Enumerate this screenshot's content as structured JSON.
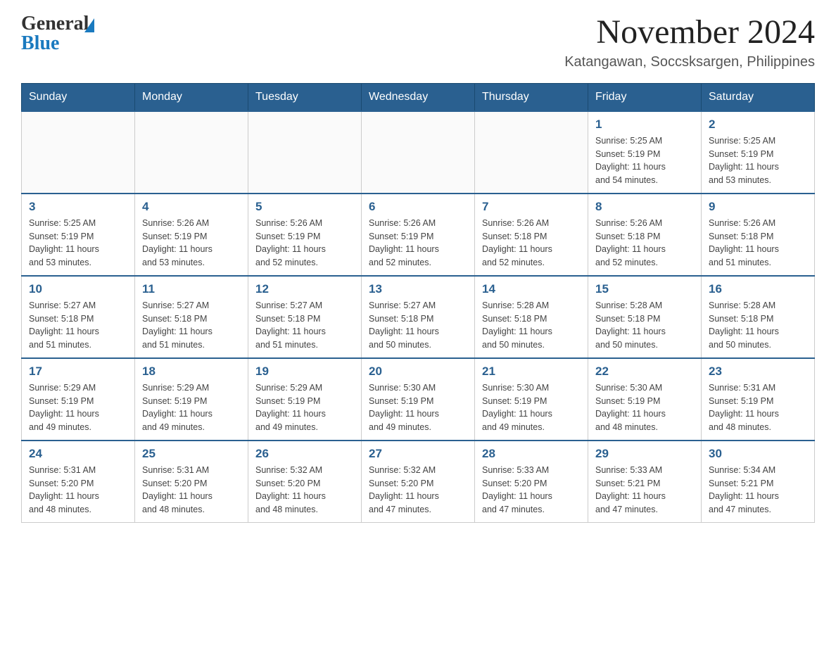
{
  "header": {
    "logo_general": "General",
    "logo_blue": "Blue",
    "month_year": "November 2024",
    "location": "Katangawan, Soccsksargen, Philippines"
  },
  "calendar": {
    "days_of_week": [
      "Sunday",
      "Monday",
      "Tuesday",
      "Wednesday",
      "Thursday",
      "Friday",
      "Saturday"
    ],
    "weeks": [
      [
        {
          "day": "",
          "info": ""
        },
        {
          "day": "",
          "info": ""
        },
        {
          "day": "",
          "info": ""
        },
        {
          "day": "",
          "info": ""
        },
        {
          "day": "",
          "info": ""
        },
        {
          "day": "1",
          "info": "Sunrise: 5:25 AM\nSunset: 5:19 PM\nDaylight: 11 hours\nand 54 minutes."
        },
        {
          "day": "2",
          "info": "Sunrise: 5:25 AM\nSunset: 5:19 PM\nDaylight: 11 hours\nand 53 minutes."
        }
      ],
      [
        {
          "day": "3",
          "info": "Sunrise: 5:25 AM\nSunset: 5:19 PM\nDaylight: 11 hours\nand 53 minutes."
        },
        {
          "day": "4",
          "info": "Sunrise: 5:26 AM\nSunset: 5:19 PM\nDaylight: 11 hours\nand 53 minutes."
        },
        {
          "day": "5",
          "info": "Sunrise: 5:26 AM\nSunset: 5:19 PM\nDaylight: 11 hours\nand 52 minutes."
        },
        {
          "day": "6",
          "info": "Sunrise: 5:26 AM\nSunset: 5:19 PM\nDaylight: 11 hours\nand 52 minutes."
        },
        {
          "day": "7",
          "info": "Sunrise: 5:26 AM\nSunset: 5:18 PM\nDaylight: 11 hours\nand 52 minutes."
        },
        {
          "day": "8",
          "info": "Sunrise: 5:26 AM\nSunset: 5:18 PM\nDaylight: 11 hours\nand 52 minutes."
        },
        {
          "day": "9",
          "info": "Sunrise: 5:26 AM\nSunset: 5:18 PM\nDaylight: 11 hours\nand 51 minutes."
        }
      ],
      [
        {
          "day": "10",
          "info": "Sunrise: 5:27 AM\nSunset: 5:18 PM\nDaylight: 11 hours\nand 51 minutes."
        },
        {
          "day": "11",
          "info": "Sunrise: 5:27 AM\nSunset: 5:18 PM\nDaylight: 11 hours\nand 51 minutes."
        },
        {
          "day": "12",
          "info": "Sunrise: 5:27 AM\nSunset: 5:18 PM\nDaylight: 11 hours\nand 51 minutes."
        },
        {
          "day": "13",
          "info": "Sunrise: 5:27 AM\nSunset: 5:18 PM\nDaylight: 11 hours\nand 50 minutes."
        },
        {
          "day": "14",
          "info": "Sunrise: 5:28 AM\nSunset: 5:18 PM\nDaylight: 11 hours\nand 50 minutes."
        },
        {
          "day": "15",
          "info": "Sunrise: 5:28 AM\nSunset: 5:18 PM\nDaylight: 11 hours\nand 50 minutes."
        },
        {
          "day": "16",
          "info": "Sunrise: 5:28 AM\nSunset: 5:18 PM\nDaylight: 11 hours\nand 50 minutes."
        }
      ],
      [
        {
          "day": "17",
          "info": "Sunrise: 5:29 AM\nSunset: 5:19 PM\nDaylight: 11 hours\nand 49 minutes."
        },
        {
          "day": "18",
          "info": "Sunrise: 5:29 AM\nSunset: 5:19 PM\nDaylight: 11 hours\nand 49 minutes."
        },
        {
          "day": "19",
          "info": "Sunrise: 5:29 AM\nSunset: 5:19 PM\nDaylight: 11 hours\nand 49 minutes."
        },
        {
          "day": "20",
          "info": "Sunrise: 5:30 AM\nSunset: 5:19 PM\nDaylight: 11 hours\nand 49 minutes."
        },
        {
          "day": "21",
          "info": "Sunrise: 5:30 AM\nSunset: 5:19 PM\nDaylight: 11 hours\nand 49 minutes."
        },
        {
          "day": "22",
          "info": "Sunrise: 5:30 AM\nSunset: 5:19 PM\nDaylight: 11 hours\nand 48 minutes."
        },
        {
          "day": "23",
          "info": "Sunrise: 5:31 AM\nSunset: 5:19 PM\nDaylight: 11 hours\nand 48 minutes."
        }
      ],
      [
        {
          "day": "24",
          "info": "Sunrise: 5:31 AM\nSunset: 5:20 PM\nDaylight: 11 hours\nand 48 minutes."
        },
        {
          "day": "25",
          "info": "Sunrise: 5:31 AM\nSunset: 5:20 PM\nDaylight: 11 hours\nand 48 minutes."
        },
        {
          "day": "26",
          "info": "Sunrise: 5:32 AM\nSunset: 5:20 PM\nDaylight: 11 hours\nand 48 minutes."
        },
        {
          "day": "27",
          "info": "Sunrise: 5:32 AM\nSunset: 5:20 PM\nDaylight: 11 hours\nand 47 minutes."
        },
        {
          "day": "28",
          "info": "Sunrise: 5:33 AM\nSunset: 5:20 PM\nDaylight: 11 hours\nand 47 minutes."
        },
        {
          "day": "29",
          "info": "Sunrise: 5:33 AM\nSunset: 5:21 PM\nDaylight: 11 hours\nand 47 minutes."
        },
        {
          "day": "30",
          "info": "Sunrise: 5:34 AM\nSunset: 5:21 PM\nDaylight: 11 hours\nand 47 minutes."
        }
      ]
    ]
  }
}
